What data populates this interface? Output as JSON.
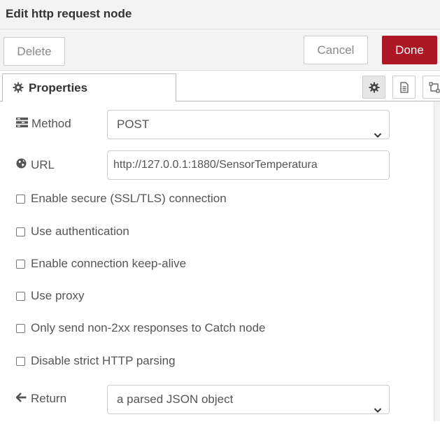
{
  "header": {
    "title": "Edit http request node"
  },
  "toolbar": {
    "delete_label": "Delete",
    "cancel_label": "Cancel",
    "done_label": "Done"
  },
  "tabs": [
    {
      "label": "Properties",
      "icon": "gear-icon",
      "active": true
    }
  ],
  "tab_icons": [
    "gear-icon",
    "document-icon",
    "appearance-icon"
  ],
  "form": {
    "method": {
      "label": "Method",
      "icon": "tasks-icon",
      "value": "POST"
    },
    "url": {
      "label": "URL",
      "icon": "globe-icon",
      "value": "http://127.0.0.1:1880/SensorTemperatura"
    },
    "checkboxes": [
      {
        "label": "Enable secure (SSL/TLS) connection",
        "checked": false
      },
      {
        "label": "Use authentication",
        "checked": false
      },
      {
        "label": "Enable connection keep-alive",
        "checked": false
      },
      {
        "label": "Use proxy",
        "checked": false
      },
      {
        "label": "Only send non-2xx responses to Catch node",
        "checked": false
      },
      {
        "label": "Disable strict HTTP parsing",
        "checked": false
      }
    ],
    "return": {
      "label": "Return",
      "icon": "arrow-left-icon",
      "value": "a parsed JSON object"
    }
  },
  "colors": {
    "done_button": "#ad1625",
    "toolbar_bg": "#f3f3f3",
    "text": "#555555"
  }
}
